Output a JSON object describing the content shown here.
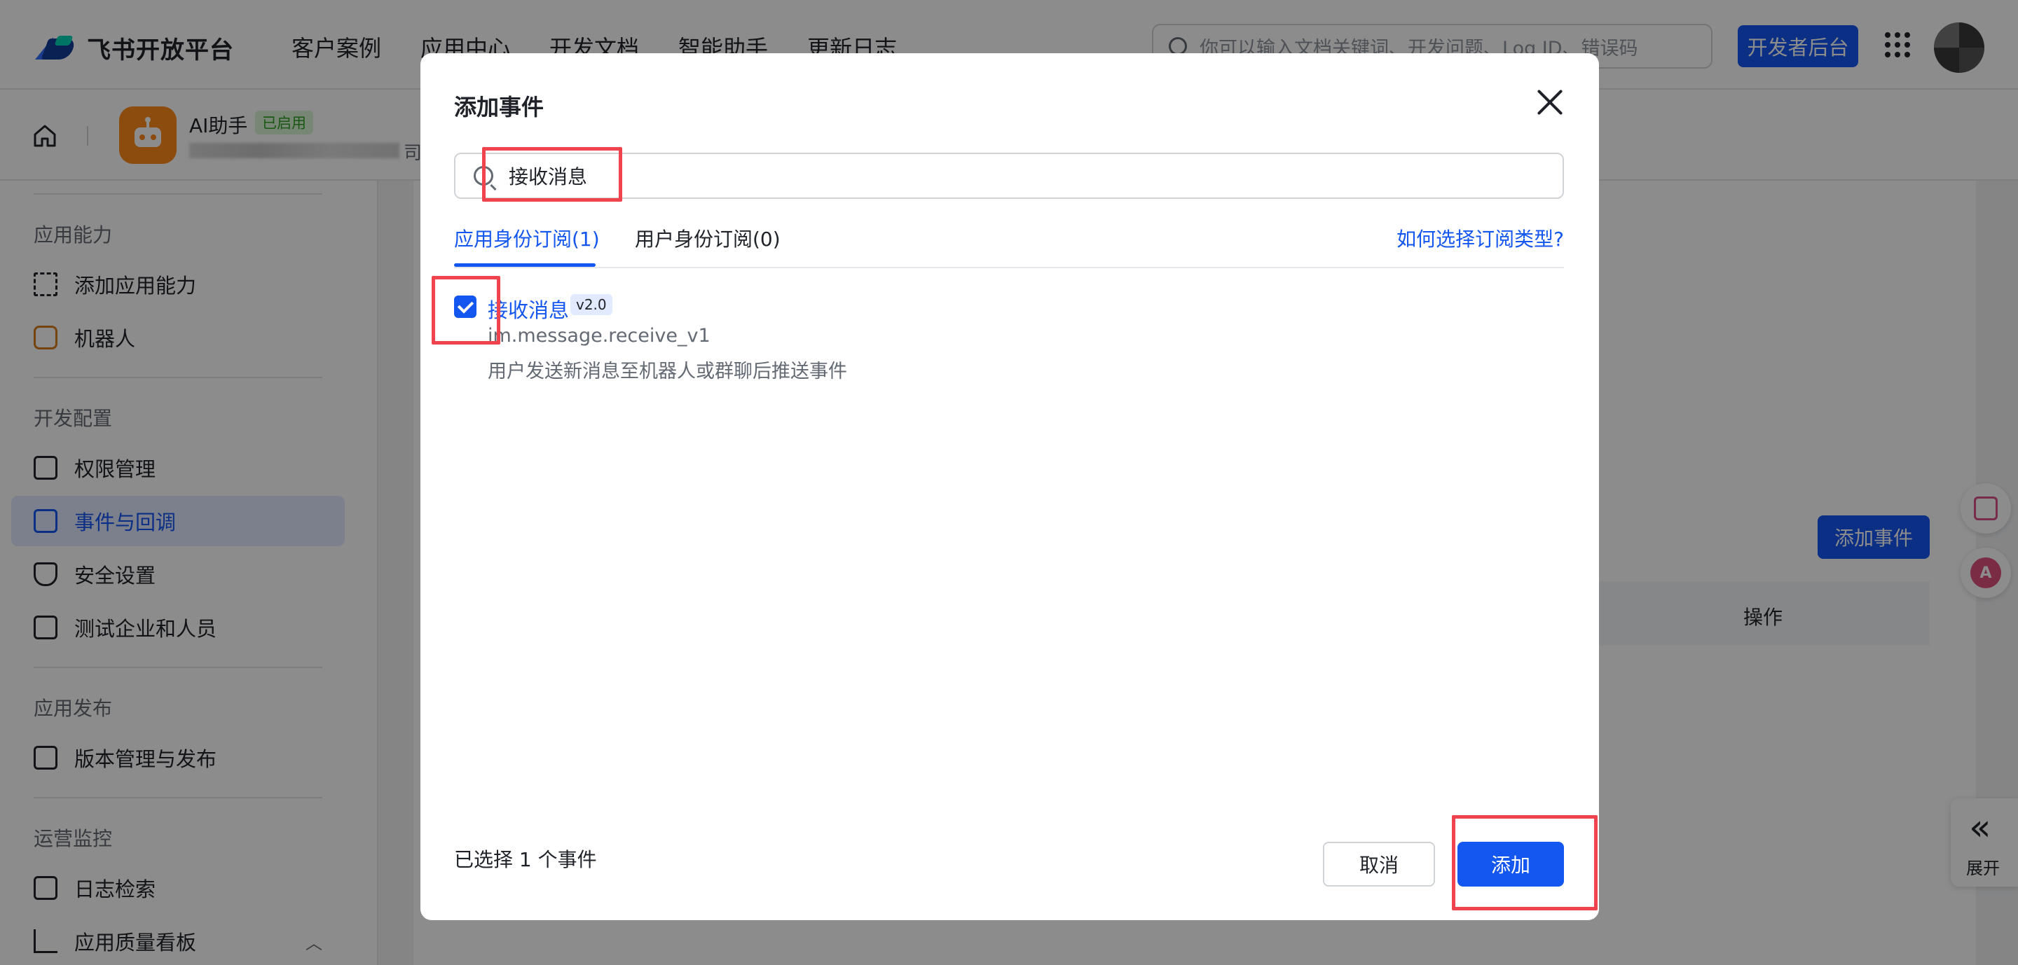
{
  "topnav": {
    "brand": "飞书开放平台",
    "links": [
      "客户案例",
      "应用中心",
      "开发文档",
      "智能助手",
      "更新日志"
    ],
    "search_placeholder": "你可以输入文档关键词、开发问题、Log ID、错误码",
    "dev_console": "开发者后台"
  },
  "app": {
    "name": "AI助手",
    "status": "已启用",
    "subtitle_tail": "司公"
  },
  "sidebar": {
    "groups": [
      {
        "title": "应用能力",
        "items": [
          {
            "label": "添加应用能力",
            "icon": "grid-add-icon"
          },
          {
            "label": "机器人",
            "icon": "robot-icon"
          }
        ]
      },
      {
        "title": "开发配置",
        "items": [
          {
            "label": "权限管理",
            "icon": "briefcase-icon"
          },
          {
            "label": "事件与回调",
            "icon": "event-icon",
            "active": true
          },
          {
            "label": "安全设置",
            "icon": "shield-icon"
          },
          {
            "label": "测试企业和人员",
            "icon": "code-icon"
          }
        ]
      },
      {
        "title": "应用发布",
        "items": [
          {
            "label": "版本管理与发布",
            "icon": "upload-icon"
          }
        ]
      },
      {
        "title": "运营监控",
        "items": [
          {
            "label": "日志检索",
            "icon": "log-search-icon"
          },
          {
            "label": "应用质量看板",
            "icon": "chart-icon"
          }
        ]
      }
    ]
  },
  "background": {
    "add_event_button": "添加事件",
    "table_col_operation": "操作",
    "expand_label": "展开"
  },
  "modal": {
    "title": "添加事件",
    "search_value": "接收消息",
    "tabs": [
      "应用身份订阅(1)",
      "用户身份订阅(0)"
    ],
    "help_link": "如何选择订阅类型?",
    "event": {
      "name": "接收消息",
      "version": "v2.0",
      "key": "im.message.receive_v1",
      "description": "用户发送新消息至机器人或群聊后推送事件",
      "checked": true
    },
    "selected_count_text": "已选择 1 个事件",
    "cancel_label": "取消",
    "add_label": "添加"
  },
  "colors": {
    "primary": "#1456f0",
    "highlight": "#f0434d",
    "badge_green": "#2ea121"
  }
}
